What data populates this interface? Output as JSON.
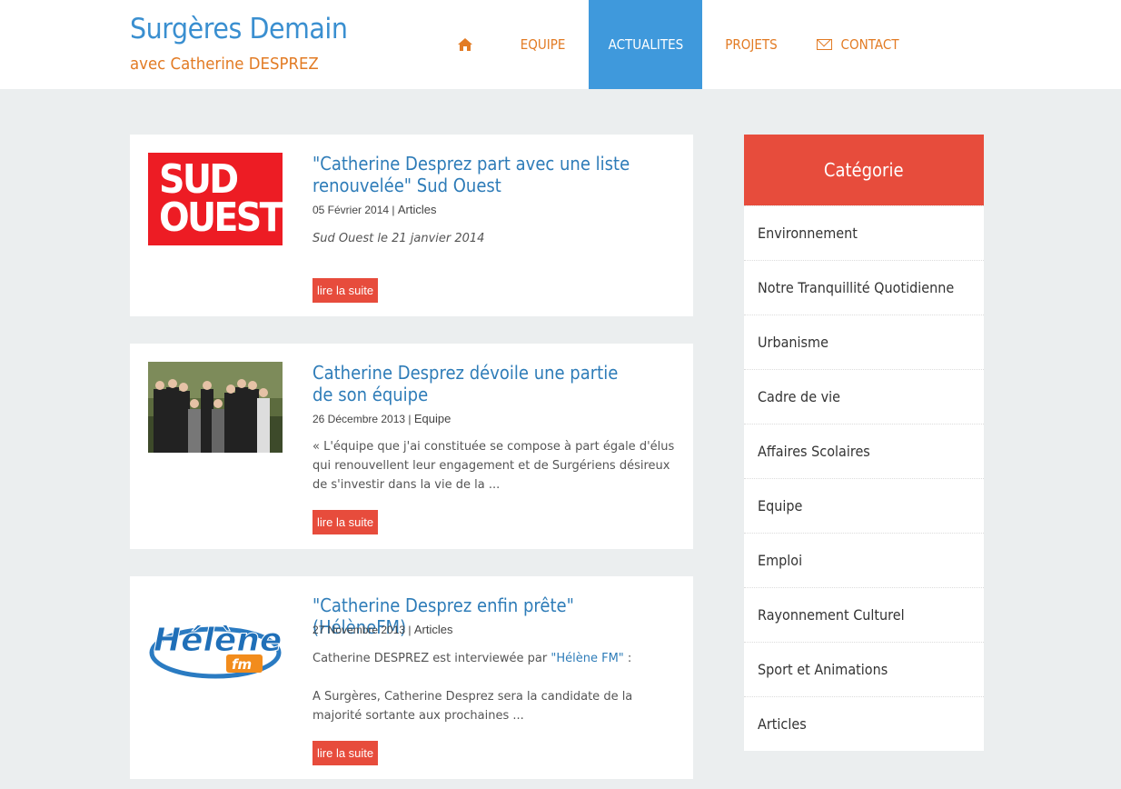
{
  "brand": {
    "title": "Surgères Demain",
    "subtitle": "avec Catherine DESPREZ"
  },
  "nav": {
    "home_icon": "home-icon",
    "items": [
      "EQUIPE",
      "ACTUALITES",
      "PROJETS",
      "CONTACT"
    ],
    "active": "ACTUALITES",
    "contact_icon": "envelope-icon"
  },
  "articles": [
    {
      "image": "sud-ouest-logo",
      "image_text": [
        "SUD",
        "OUEST"
      ],
      "title": "\"Catherine Desprez part avec une liste renouvelée\" Sud Ouest",
      "date": "05 Février 2014",
      "category": "Articles",
      "excerpt": "Sud Ouest le 21 janvier 2014",
      "read_more": "lire la suite"
    },
    {
      "image": "team-photo",
      "title": "Catherine Desprez dévoile une partie de son équipe",
      "date": "26 Décembre 2013",
      "category": "Equipe",
      "excerpt": "«  L'équipe que j'ai constituée se compose à part égale d'élus qui renouvellent leur engagement et de Surgériens désireux de s'investir dans la vie de la ...",
      "read_more": "lire la suite"
    },
    {
      "image": "helene-fm-logo",
      "image_text": [
        "Hélène",
        "fm"
      ],
      "title": "\"Catherine Desprez enfin prête\" (HélèneFM)",
      "date": "27 Novembre 2013",
      "category": "Articles",
      "excerpt_line1_pre": "Catherine DESPREZ est interviewée par ",
      "excerpt_link": "\"Hélène FM\"",
      "excerpt_line1_post": " :",
      "excerpt_line2": "A Surgères, Catherine Desprez sera la candidate de la majorité sortante aux prochaines ...",
      "read_more": "lire la suite"
    }
  ],
  "sidebar": {
    "title": "Catégorie",
    "items": [
      "Environnement",
      "Notre Tranquillité Quotidienne",
      "Urbanisme",
      "Cadre de vie",
      "Affaires Scolaires",
      "Equipe",
      "Emploi",
      "Rayonnement Culturel",
      "Sport et Animations",
      "Articles"
    ]
  },
  "colors": {
    "brand_blue": "#3a8fd0",
    "brand_orange": "#e27b24",
    "nav_active": "#3f99dc",
    "accent_red": "#e74c3c",
    "background": "#ebeeef"
  }
}
